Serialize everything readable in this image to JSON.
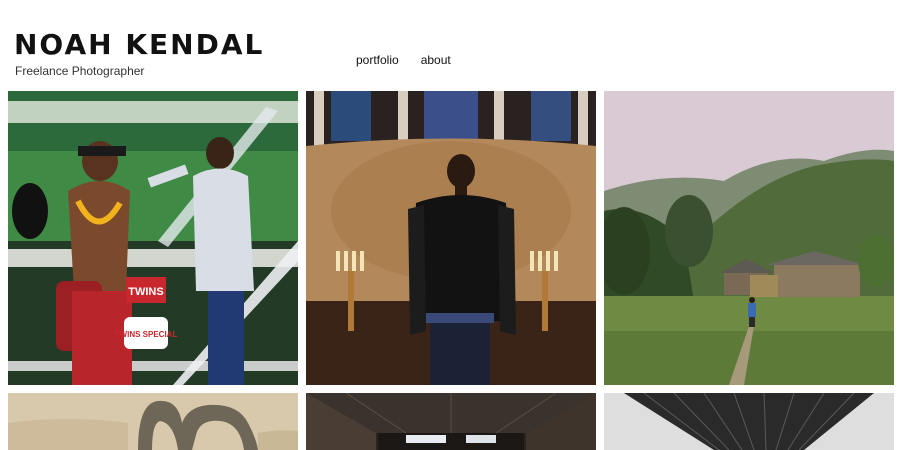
{
  "site": {
    "title": "NOAH KENDAL",
    "subtitle": "Freelance Photographer"
  },
  "nav": {
    "items": [
      "portfolio",
      "about"
    ]
  },
  "gallery": {
    "photos": [
      {
        "name": "photo-muay-thai",
        "overlay_text": [
          "TWINS",
          "TWINS SPECIAL"
        ]
      },
      {
        "name": "photo-man-in-church"
      },
      {
        "name": "photo-mountain-valley"
      },
      {
        "name": "photo-desert-sculpture"
      },
      {
        "name": "photo-office-ceiling"
      },
      {
        "name": "photo-architecture"
      }
    ]
  }
}
